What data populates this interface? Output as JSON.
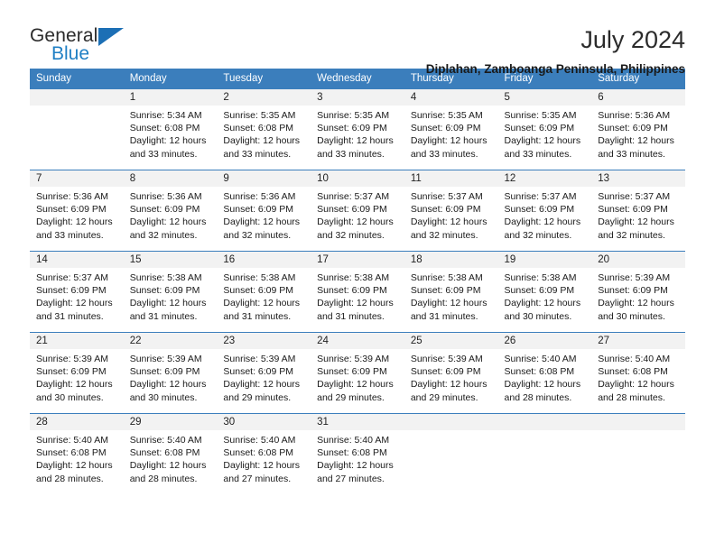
{
  "brand": {
    "name_part1": "General",
    "name_part2": "Blue",
    "accent_color": "#1c6fb5"
  },
  "header": {
    "month_title": "July 2024",
    "location": "Diplahan, Zamboanga Peninsula, Philippines"
  },
  "calendar": {
    "header_bg": "#3b7ebc",
    "daynum_bg": "#f2f2f2",
    "weekday_headers": [
      "Sunday",
      "Monday",
      "Tuesday",
      "Wednesday",
      "Thursday",
      "Friday",
      "Saturday"
    ],
    "weeks": [
      [
        {
          "day": "",
          "sunrise": "",
          "sunset": "",
          "daylight_line1": "",
          "daylight_line2": "",
          "empty": true
        },
        {
          "day": "1",
          "sunrise": "Sunrise: 5:34 AM",
          "sunset": "Sunset: 6:08 PM",
          "daylight_line1": "Daylight: 12 hours",
          "daylight_line2": "and 33 minutes."
        },
        {
          "day": "2",
          "sunrise": "Sunrise: 5:35 AM",
          "sunset": "Sunset: 6:08 PM",
          "daylight_line1": "Daylight: 12 hours",
          "daylight_line2": "and 33 minutes."
        },
        {
          "day": "3",
          "sunrise": "Sunrise: 5:35 AM",
          "sunset": "Sunset: 6:09 PM",
          "daylight_line1": "Daylight: 12 hours",
          "daylight_line2": "and 33 minutes."
        },
        {
          "day": "4",
          "sunrise": "Sunrise: 5:35 AM",
          "sunset": "Sunset: 6:09 PM",
          "daylight_line1": "Daylight: 12 hours",
          "daylight_line2": "and 33 minutes."
        },
        {
          "day": "5",
          "sunrise": "Sunrise: 5:35 AM",
          "sunset": "Sunset: 6:09 PM",
          "daylight_line1": "Daylight: 12 hours",
          "daylight_line2": "and 33 minutes."
        },
        {
          "day": "6",
          "sunrise": "Sunrise: 5:36 AM",
          "sunset": "Sunset: 6:09 PM",
          "daylight_line1": "Daylight: 12 hours",
          "daylight_line2": "and 33 minutes."
        }
      ],
      [
        {
          "day": "7",
          "sunrise": "Sunrise: 5:36 AM",
          "sunset": "Sunset: 6:09 PM",
          "daylight_line1": "Daylight: 12 hours",
          "daylight_line2": "and 33 minutes."
        },
        {
          "day": "8",
          "sunrise": "Sunrise: 5:36 AM",
          "sunset": "Sunset: 6:09 PM",
          "daylight_line1": "Daylight: 12 hours",
          "daylight_line2": "and 32 minutes."
        },
        {
          "day": "9",
          "sunrise": "Sunrise: 5:36 AM",
          "sunset": "Sunset: 6:09 PM",
          "daylight_line1": "Daylight: 12 hours",
          "daylight_line2": "and 32 minutes."
        },
        {
          "day": "10",
          "sunrise": "Sunrise: 5:37 AM",
          "sunset": "Sunset: 6:09 PM",
          "daylight_line1": "Daylight: 12 hours",
          "daylight_line2": "and 32 minutes."
        },
        {
          "day": "11",
          "sunrise": "Sunrise: 5:37 AM",
          "sunset": "Sunset: 6:09 PM",
          "daylight_line1": "Daylight: 12 hours",
          "daylight_line2": "and 32 minutes."
        },
        {
          "day": "12",
          "sunrise": "Sunrise: 5:37 AM",
          "sunset": "Sunset: 6:09 PM",
          "daylight_line1": "Daylight: 12 hours",
          "daylight_line2": "and 32 minutes."
        },
        {
          "day": "13",
          "sunrise": "Sunrise: 5:37 AM",
          "sunset": "Sunset: 6:09 PM",
          "daylight_line1": "Daylight: 12 hours",
          "daylight_line2": "and 32 minutes."
        }
      ],
      [
        {
          "day": "14",
          "sunrise": "Sunrise: 5:37 AM",
          "sunset": "Sunset: 6:09 PM",
          "daylight_line1": "Daylight: 12 hours",
          "daylight_line2": "and 31 minutes."
        },
        {
          "day": "15",
          "sunrise": "Sunrise: 5:38 AM",
          "sunset": "Sunset: 6:09 PM",
          "daylight_line1": "Daylight: 12 hours",
          "daylight_line2": "and 31 minutes."
        },
        {
          "day": "16",
          "sunrise": "Sunrise: 5:38 AM",
          "sunset": "Sunset: 6:09 PM",
          "daylight_line1": "Daylight: 12 hours",
          "daylight_line2": "and 31 minutes."
        },
        {
          "day": "17",
          "sunrise": "Sunrise: 5:38 AM",
          "sunset": "Sunset: 6:09 PM",
          "daylight_line1": "Daylight: 12 hours",
          "daylight_line2": "and 31 minutes."
        },
        {
          "day": "18",
          "sunrise": "Sunrise: 5:38 AM",
          "sunset": "Sunset: 6:09 PM",
          "daylight_line1": "Daylight: 12 hours",
          "daylight_line2": "and 31 minutes."
        },
        {
          "day": "19",
          "sunrise": "Sunrise: 5:38 AM",
          "sunset": "Sunset: 6:09 PM",
          "daylight_line1": "Daylight: 12 hours",
          "daylight_line2": "and 30 minutes."
        },
        {
          "day": "20",
          "sunrise": "Sunrise: 5:39 AM",
          "sunset": "Sunset: 6:09 PM",
          "daylight_line1": "Daylight: 12 hours",
          "daylight_line2": "and 30 minutes."
        }
      ],
      [
        {
          "day": "21",
          "sunrise": "Sunrise: 5:39 AM",
          "sunset": "Sunset: 6:09 PM",
          "daylight_line1": "Daylight: 12 hours",
          "daylight_line2": "and 30 minutes."
        },
        {
          "day": "22",
          "sunrise": "Sunrise: 5:39 AM",
          "sunset": "Sunset: 6:09 PM",
          "daylight_line1": "Daylight: 12 hours",
          "daylight_line2": "and 30 minutes."
        },
        {
          "day": "23",
          "sunrise": "Sunrise: 5:39 AM",
          "sunset": "Sunset: 6:09 PM",
          "daylight_line1": "Daylight: 12 hours",
          "daylight_line2": "and 29 minutes."
        },
        {
          "day": "24",
          "sunrise": "Sunrise: 5:39 AM",
          "sunset": "Sunset: 6:09 PM",
          "daylight_line1": "Daylight: 12 hours",
          "daylight_line2": "and 29 minutes."
        },
        {
          "day": "25",
          "sunrise": "Sunrise: 5:39 AM",
          "sunset": "Sunset: 6:09 PM",
          "daylight_line1": "Daylight: 12 hours",
          "daylight_line2": "and 29 minutes."
        },
        {
          "day": "26",
          "sunrise": "Sunrise: 5:40 AM",
          "sunset": "Sunset: 6:08 PM",
          "daylight_line1": "Daylight: 12 hours",
          "daylight_line2": "and 28 minutes."
        },
        {
          "day": "27",
          "sunrise": "Sunrise: 5:40 AM",
          "sunset": "Sunset: 6:08 PM",
          "daylight_line1": "Daylight: 12 hours",
          "daylight_line2": "and 28 minutes."
        }
      ],
      [
        {
          "day": "28",
          "sunrise": "Sunrise: 5:40 AM",
          "sunset": "Sunset: 6:08 PM",
          "daylight_line1": "Daylight: 12 hours",
          "daylight_line2": "and 28 minutes."
        },
        {
          "day": "29",
          "sunrise": "Sunrise: 5:40 AM",
          "sunset": "Sunset: 6:08 PM",
          "daylight_line1": "Daylight: 12 hours",
          "daylight_line2": "and 28 minutes."
        },
        {
          "day": "30",
          "sunrise": "Sunrise: 5:40 AM",
          "sunset": "Sunset: 6:08 PM",
          "daylight_line1": "Daylight: 12 hours",
          "daylight_line2": "and 27 minutes."
        },
        {
          "day": "31",
          "sunrise": "Sunrise: 5:40 AM",
          "sunset": "Sunset: 6:08 PM",
          "daylight_line1": "Daylight: 12 hours",
          "daylight_line2": "and 27 minutes."
        },
        {
          "day": "",
          "sunrise": "",
          "sunset": "",
          "daylight_line1": "",
          "daylight_line2": "",
          "empty": true
        },
        {
          "day": "",
          "sunrise": "",
          "sunset": "",
          "daylight_line1": "",
          "daylight_line2": "",
          "empty": true
        },
        {
          "day": "",
          "sunrise": "",
          "sunset": "",
          "daylight_line1": "",
          "daylight_line2": "",
          "empty": true
        }
      ]
    ]
  }
}
